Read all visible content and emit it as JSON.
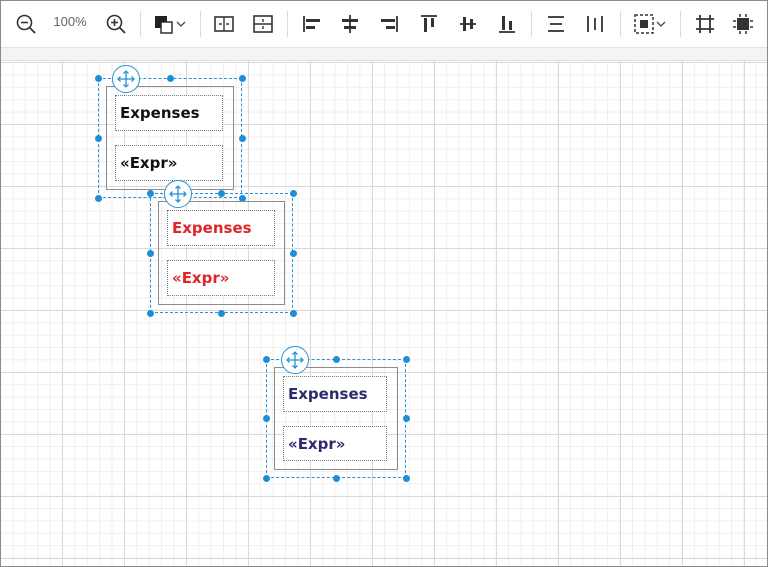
{
  "toolbar": {
    "zoom_level": "100%",
    "icons": [
      "zoom-out-icon",
      "zoom-in-icon",
      "fill-color-icon",
      "chevron-down-icon",
      "distribute-horizontal-icon",
      "distribute-vertical-icon",
      "align-left-icon",
      "align-center-icon",
      "align-right-icon",
      "align-top-icon",
      "align-middle-icon",
      "align-bottom-icon",
      "same-height-icon",
      "same-width-icon",
      "selection-mode-icon",
      "crop-icon",
      "fit-to-page-icon"
    ]
  },
  "colors": {
    "accent": "#1e8ed8",
    "text_black": "#111111",
    "text_red": "#e0262b",
    "text_navy": "#2d2a6e"
  },
  "shapes": [
    {
      "header_text": "Expenses",
      "value_text": "«Expr»",
      "text_color": "#111111"
    },
    {
      "header_text": "Expenses",
      "value_text": "«Expr»",
      "text_color": "#e0262b"
    },
    {
      "header_text": "Expenses",
      "value_text": "«Expr»",
      "text_color": "#2d2a6e"
    }
  ]
}
